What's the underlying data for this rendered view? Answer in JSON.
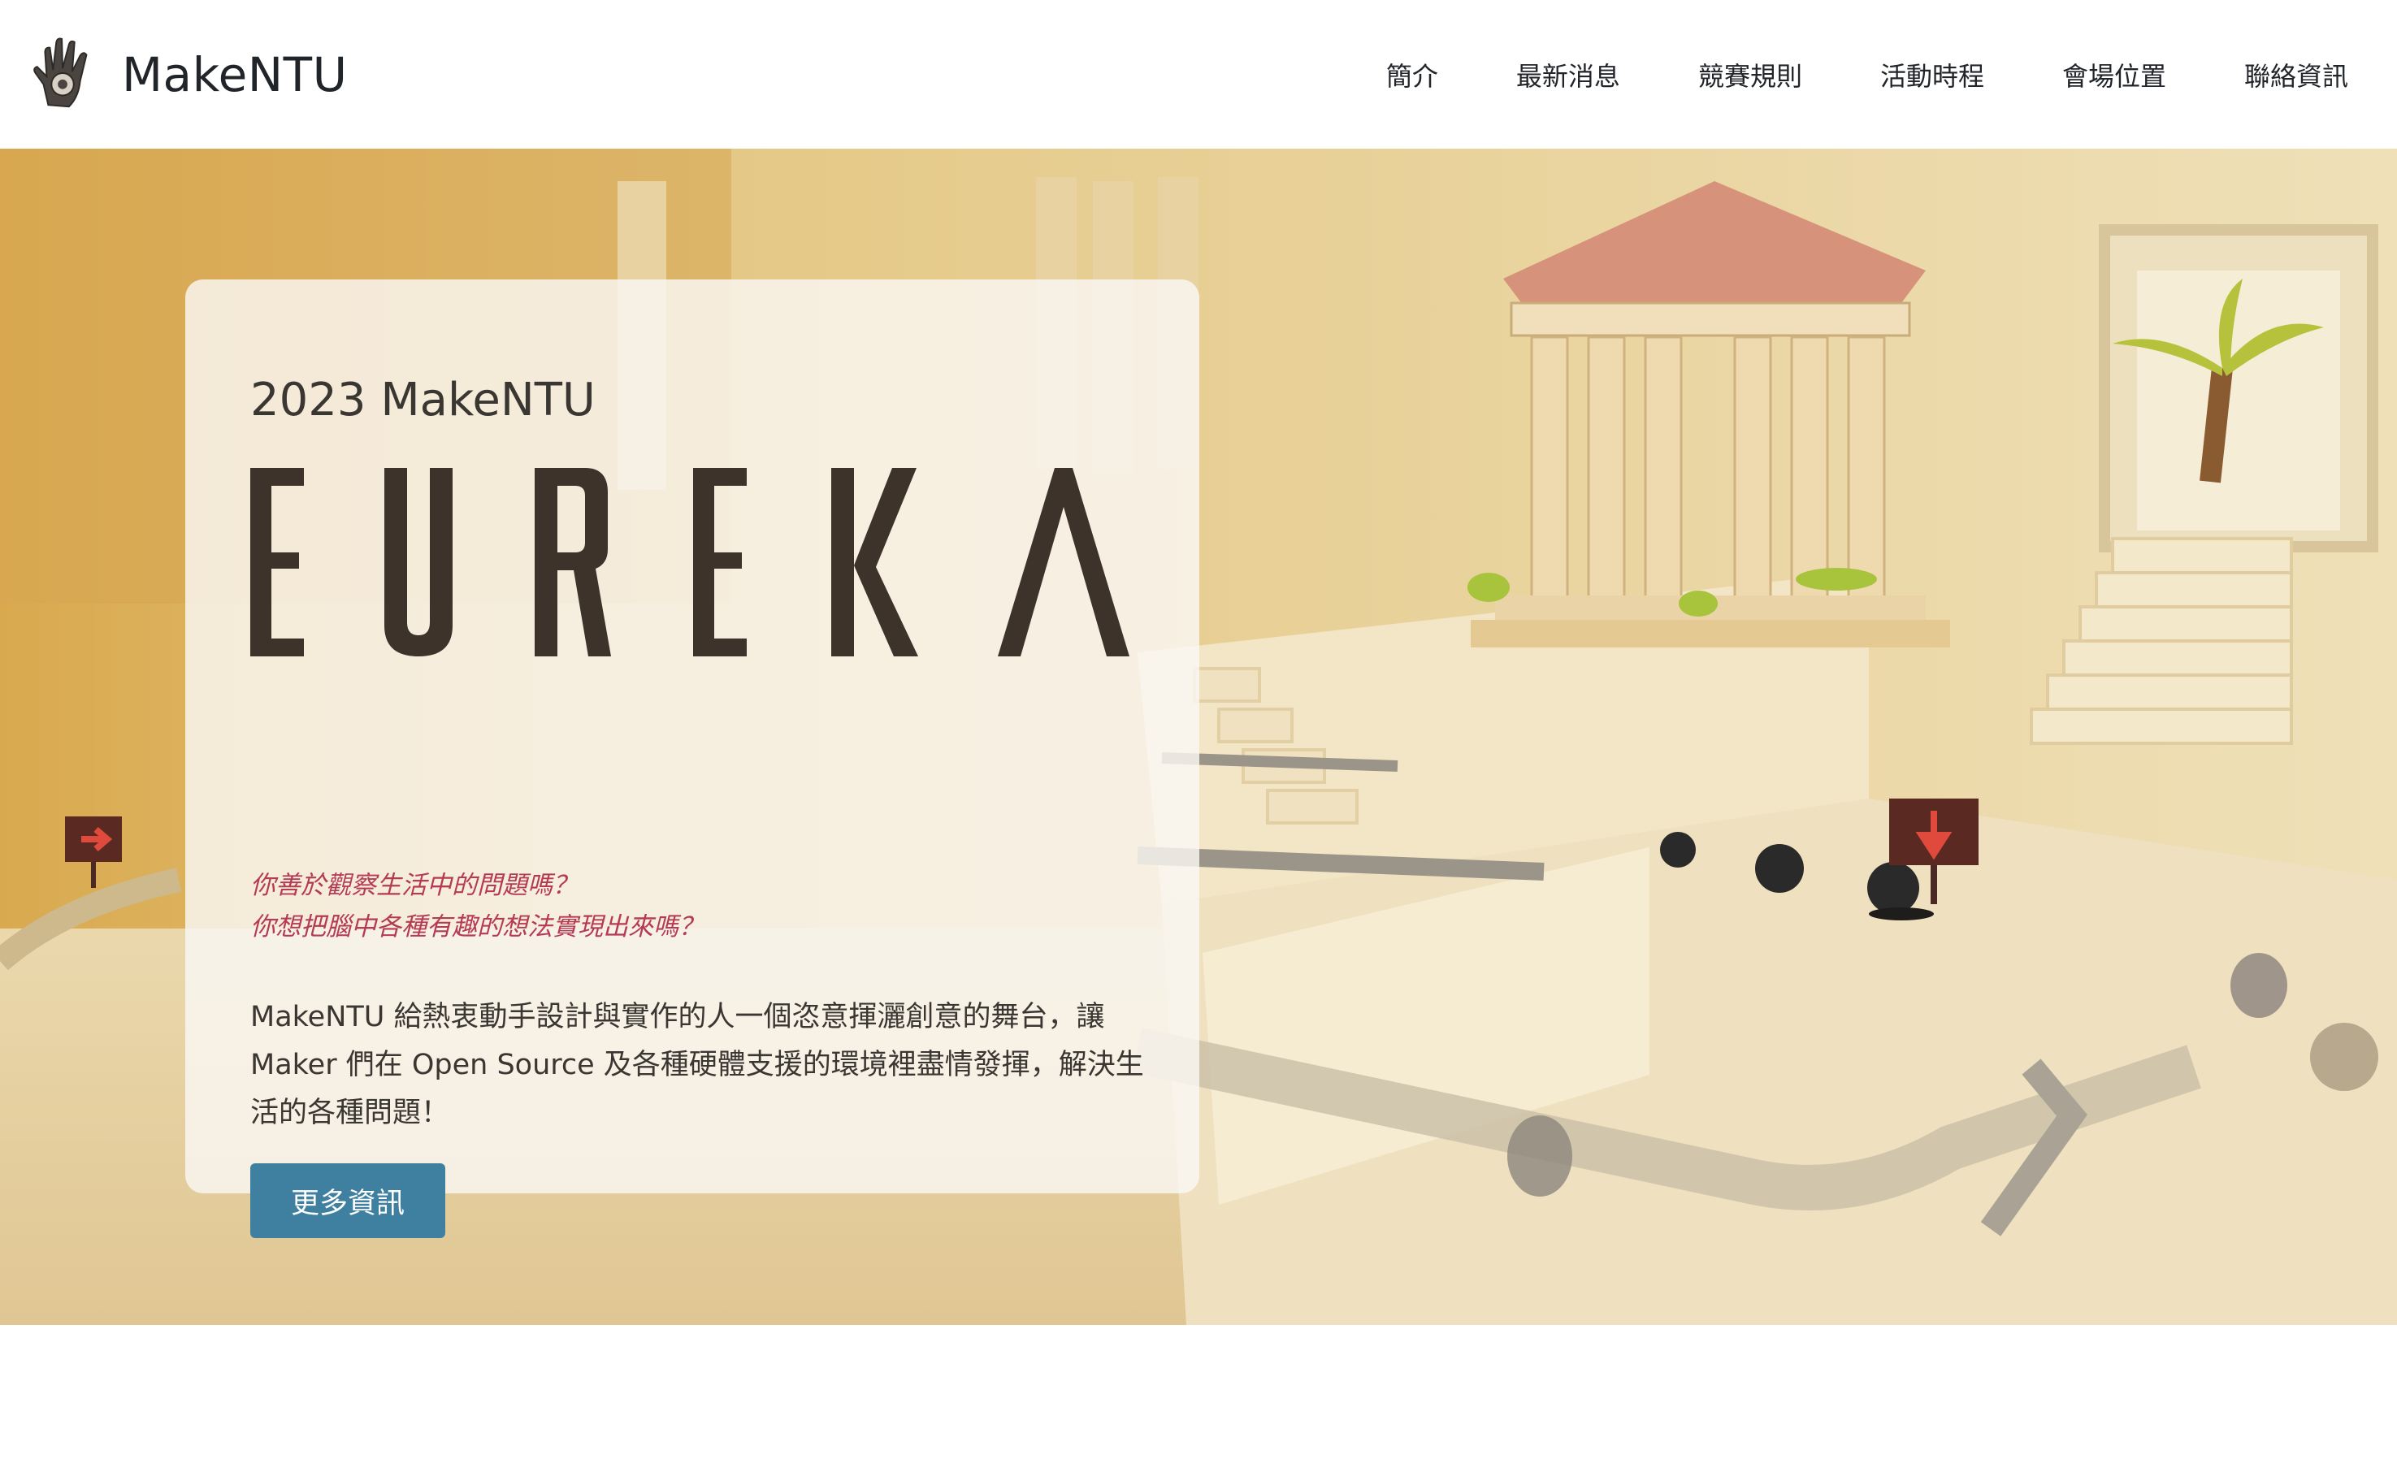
{
  "brand": {
    "name": "MakeNTU"
  },
  "nav": {
    "items": [
      {
        "label": "簡介",
        "name": "nav-item-intro"
      },
      {
        "label": "最新消息",
        "name": "nav-item-news"
      },
      {
        "label": "競賽規則",
        "name": "nav-item-rules"
      },
      {
        "label": "活動時程",
        "name": "nav-item-schedule"
      },
      {
        "label": "會場位置",
        "name": "nav-item-venue"
      },
      {
        "label": "聯絡資訊",
        "name": "nav-item-contact"
      }
    ]
  },
  "hero": {
    "year_title": "2023 MakeNTU",
    "logo_text": "EUREKA",
    "questions": [
      "你善於觀察生活中的問題嗎？",
      "你想把腦中各種有趣的想法實現出來嗎？"
    ],
    "description": "MakeNTU 給熱衷動手設計與實作的人一個恣意揮灑創意的舞台，讓 Maker 們在 Open Source 及各種硬體支援的環境裡盡情發揮，解決生活的各種問題！",
    "button_label": "更多資訊"
  },
  "colors": {
    "accent_button": "#3f7fa0",
    "question_text": "#b53a55",
    "hero_background": "#e9d7a6"
  }
}
